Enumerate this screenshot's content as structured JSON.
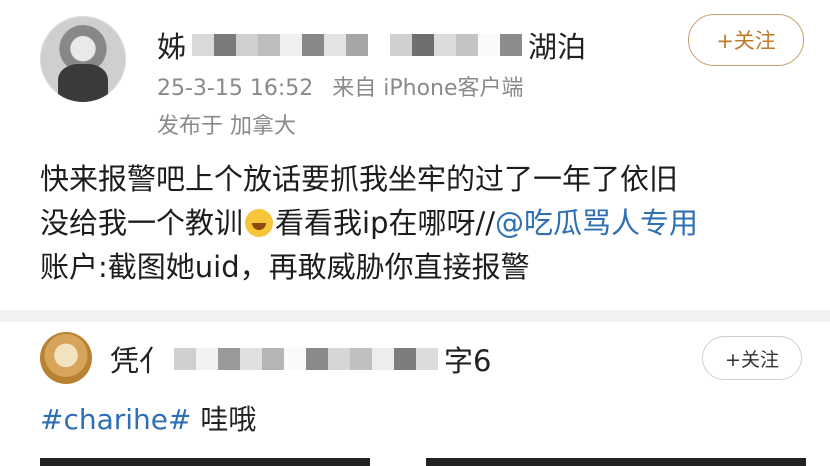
{
  "post1": {
    "name_start": "姊",
    "name_end": "湖泊",
    "time": "25-3-15 16:52",
    "source": "来自 iPhone客户端",
    "location": "发布于 加拿大",
    "follow_label": "+关注",
    "body_line1": "快来报警吧上个放话要抓我坐牢的过了一年了依旧",
    "body_line2_pre": "没给我一个教训",
    "body_line2_mid": "看看我ip在哪呀//",
    "body_line2_link": "@吃瓜骂人专用",
    "body_line3": "账户:截图她uid，再敢威胁你直接报警"
  },
  "post2": {
    "name_start": "凭亻",
    "name_end": "字6",
    "follow_label": "+关注",
    "tag": "#charihe#",
    "text": " 哇哦"
  }
}
